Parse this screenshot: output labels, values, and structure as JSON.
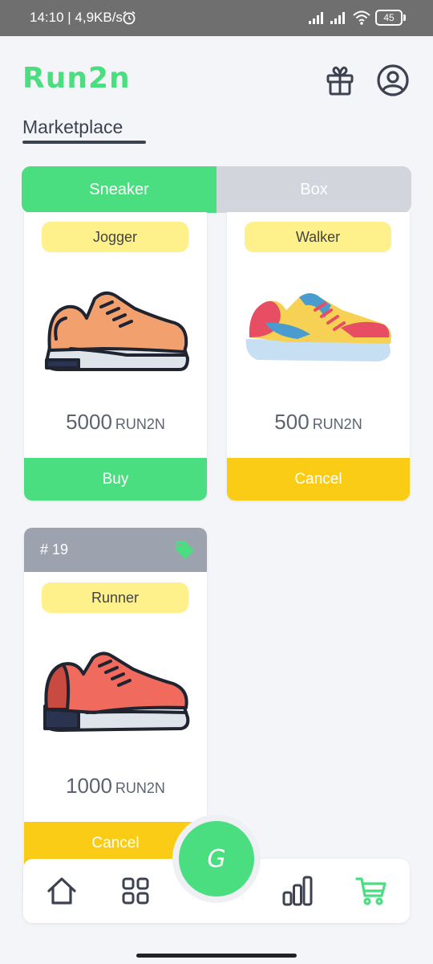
{
  "status_bar": {
    "time": "14:10 | 4,9KB/s",
    "battery": "45"
  },
  "app": {
    "logo": "Run2n",
    "page_title": "Marketplace"
  },
  "tabs": [
    {
      "label": "Sneaker",
      "active": true
    },
    {
      "label": "Box",
      "active": false
    }
  ],
  "cards": [
    {
      "type": "Jogger",
      "price": "5000",
      "currency": "RUN2N",
      "action": "Buy",
      "shoe_color": "#f3a06f"
    },
    {
      "type": "Walker",
      "price": "500",
      "currency": "RUN2N",
      "action": "Cancel"
    },
    {
      "id": "# 19",
      "type": "Runner",
      "price": "1000",
      "currency": "RUN2N",
      "action": "Cancel",
      "shoe_color": "#f06a5d"
    }
  ],
  "fab": {
    "label": "G"
  },
  "colors": {
    "accent": "#4ade80",
    "cancel": "#facc15",
    "badge": "#fef08a",
    "text": "#3c4250"
  }
}
